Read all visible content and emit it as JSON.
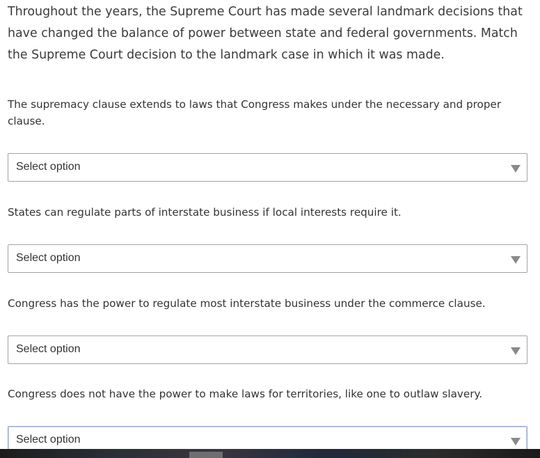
{
  "intro": "Throughout the years, the Supreme Court has made several landmark decisions that have changed the balance of power between state and federal governments. Match the Supreme Court decision to the landmark case in which it was made.",
  "questions": [
    {
      "prompt": "The supremacy clause extends to laws that Congress makes under the necessary and proper clause.",
      "select_value": "Select option"
    },
    {
      "prompt": "States can regulate parts of interstate business if local interests require it.",
      "select_value": "Select option"
    },
    {
      "prompt": "Congress has the power to regulate most interstate business under the commerce clause.",
      "select_value": "Select option"
    },
    {
      "prompt": "Congress does not have the power to make laws for territories, like one to outlaw slavery.",
      "select_value": "Select option"
    }
  ],
  "colors": {
    "text": "#333333",
    "border": "#a3a3a3",
    "caret": "#8a8a8a"
  },
  "icons": {
    "dropdown": "caret-down-icon"
  }
}
